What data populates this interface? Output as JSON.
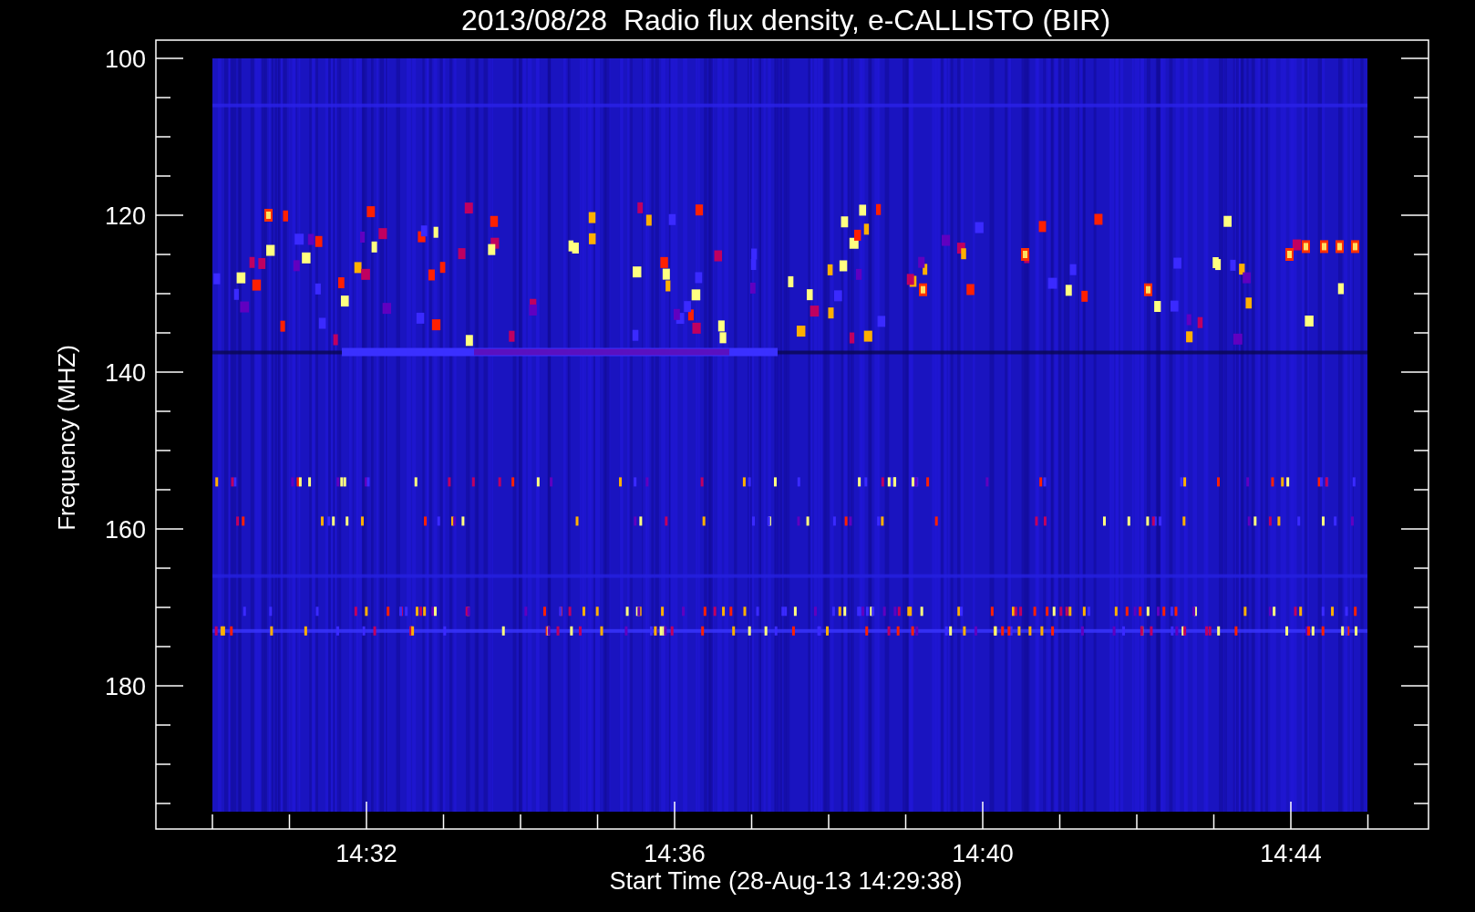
{
  "title": "2013/08/28  Radio flux density, e-CALLISTO (BIR)",
  "y_axis": {
    "label": "Frequency (MHZ)",
    "ticks": [
      "100",
      "120",
      "140",
      "160",
      "180"
    ]
  },
  "x_axis": {
    "label": "Start Time (28-Aug-13 14:29:38)",
    "ticks": [
      "14:32",
      "14:36",
      "14:40",
      "14:44"
    ]
  }
}
